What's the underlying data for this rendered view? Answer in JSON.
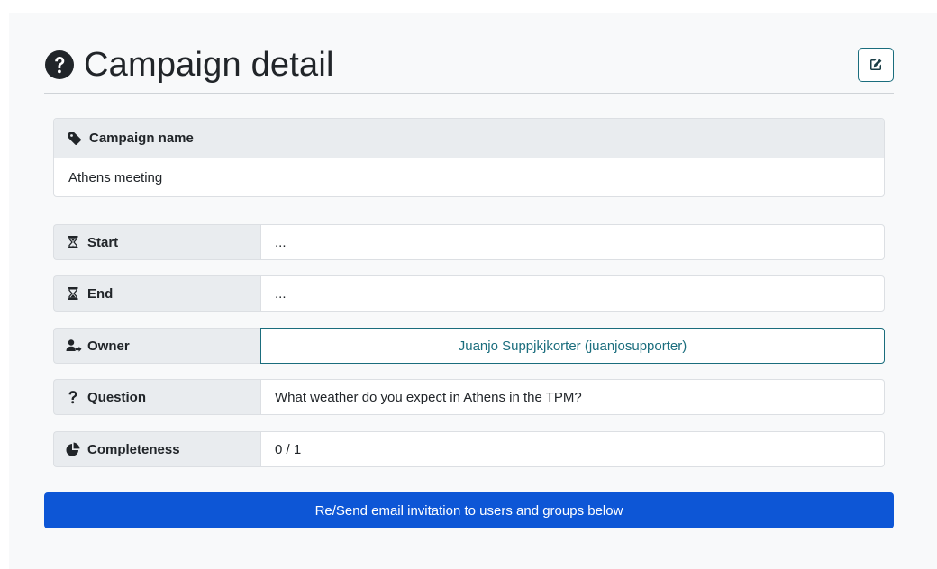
{
  "header": {
    "title": "Campaign detail",
    "title_icon": "question-circle-icon",
    "edit_icon": "edit-icon"
  },
  "campaign_name": {
    "label": "Campaign name",
    "icon": "tag-icon",
    "value": "Athens meeting"
  },
  "fields": {
    "start": {
      "label": "Start",
      "icon": "hourglass-start-icon",
      "value": "..."
    },
    "end": {
      "label": "End",
      "icon": "hourglass-end-icon",
      "value": "..."
    },
    "owner": {
      "label": "Owner",
      "icon": "user-arrow-icon",
      "value": "Juanjo Suppjkjkorter (juanjosupporter)"
    },
    "question": {
      "label": "Question",
      "icon": "question-icon",
      "value": "What weather do you expect in Athens in the TPM?"
    },
    "completeness": {
      "label": "Completeness",
      "icon": "pie-chart-icon",
      "value": "0 / 1"
    }
  },
  "actions": {
    "send_label": "Re/Send email invitation to users and groups below"
  },
  "colors": {
    "primary": "#0d56d6",
    "owner_link": "#1a6d7d",
    "label_bg": "#e9ecef"
  }
}
